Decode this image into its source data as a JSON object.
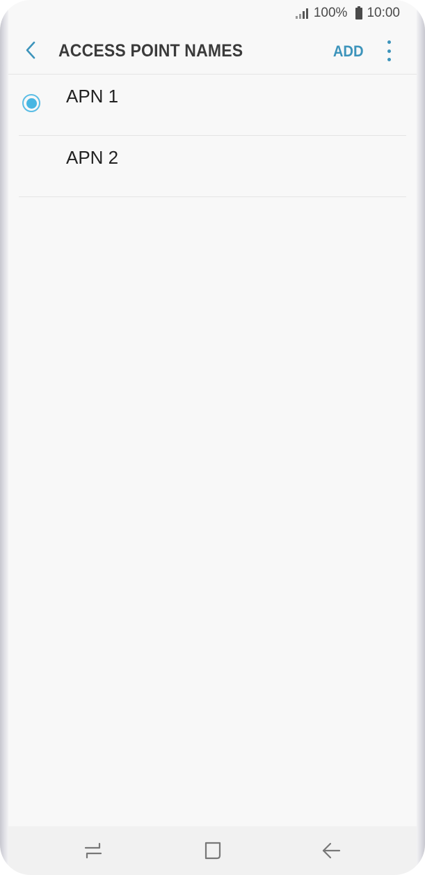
{
  "status_bar": {
    "battery_percent": "100%",
    "time": "10:00",
    "icons": [
      "signal-icon",
      "battery-icon"
    ]
  },
  "app_bar": {
    "title": "ACCESS POINT NAMES",
    "add_label": "ADD",
    "icons": [
      "back-arrow-icon",
      "more-options-icon"
    ],
    "accent_color": "#3d94bb"
  },
  "apn_list": {
    "items": [
      {
        "label": "APN 1",
        "selected": true
      },
      {
        "label": "APN 2",
        "selected": false
      }
    ],
    "radio_color": "#48b6e2"
  },
  "nav_bar": {
    "icons": [
      "recent-apps-icon",
      "home-icon",
      "back-icon"
    ]
  }
}
